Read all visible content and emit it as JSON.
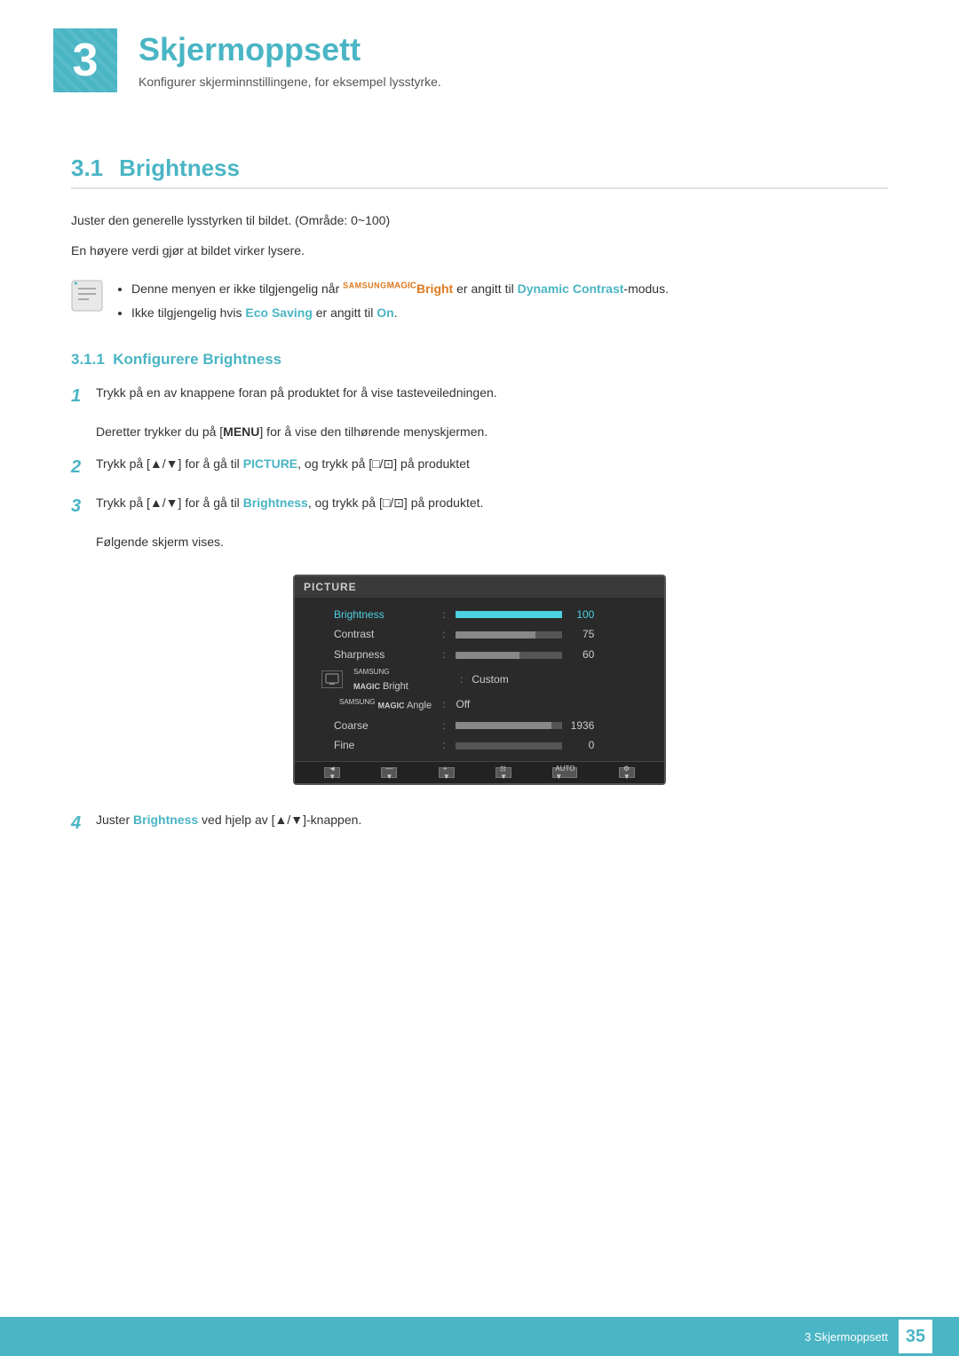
{
  "chapter": {
    "number": "3",
    "title": "Skjermoppsett",
    "subtitle": "Konfigurer skjerminnstillingene, for eksempel lysstyrke."
  },
  "section31": {
    "number": "3.1",
    "title": "Brightness",
    "description1": "Juster den generelle lysstyrken til bildet. (Område: 0~100)",
    "description2": "En høyere verdi gjør at bildet virker lysere.",
    "note1": "Denne menyen er ikke tilgjengelig når ",
    "note1_brand": "SAMSUNG",
    "note1_magic": "MAGIC",
    "note1_product": "Bright",
    "note1_mid": " er angitt til ",
    "note1_setting": "Dynamic Contrast",
    "note1_suffix": "-modus.",
    "note2_prefix": "Ikke tilgjengelig hvis ",
    "note2_setting": "Eco Saving",
    "note2_mid": " er angitt til ",
    "note2_value": "On",
    "note2_suffix": "."
  },
  "subsection311": {
    "number": "3.1.1",
    "title": "Konfigurere Brightness"
  },
  "steps": [
    {
      "num": "1",
      "text": "Trykk på en av knappene foran på produktet for å vise tasteveiledningen.",
      "subtext": "Deretter trykker du på [MENU] for å vise den tilhørende menyskjermen."
    },
    {
      "num": "2",
      "text": "Trykk på [▲/▼] for å gå til PICTURE, og trykk på [□/⊡] på produktet"
    },
    {
      "num": "3",
      "text": "Trykk på [▲/▼] for å gå til Brightness, og trykk på [□/⊡] på produktet.",
      "subtext": "Følgende skjerm vises."
    },
    {
      "num": "4",
      "text": "Juster Brightness ved hjelp av [▲/▼]-knappen."
    }
  ],
  "monitor": {
    "header": "PICTURE",
    "rows": [
      {
        "label": "Brightness",
        "type": "bar",
        "fill": 100,
        "value": "100",
        "active": true
      },
      {
        "label": "Contrast",
        "type": "bar",
        "fill": 75,
        "value": "75",
        "active": false
      },
      {
        "label": "Sharpness",
        "type": "bar",
        "fill": 60,
        "value": "60",
        "active": false
      },
      {
        "label": "SAMSUNG MAGIC Bright",
        "type": "text",
        "textval": "Custom",
        "active": false
      },
      {
        "label": "SAMSUNG MAGIC Angle",
        "type": "text",
        "textval": "Off",
        "active": false
      },
      {
        "label": "Coarse",
        "type": "bar",
        "fill": 90,
        "value": "1936",
        "active": false
      },
      {
        "label": "Fine",
        "type": "bar",
        "fill": 0,
        "value": "0",
        "active": false
      }
    ],
    "footer_btns": [
      "◄",
      "—",
      "+",
      "⊡",
      "AUTO",
      "⚙"
    ]
  },
  "footer": {
    "chapter_label": "3 Skjermoppsett",
    "page_number": "35"
  }
}
